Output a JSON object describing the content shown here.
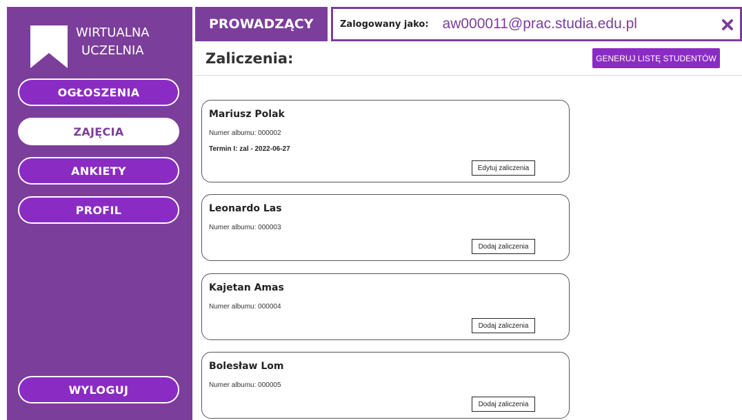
{
  "app": {
    "logo_line1": "WIRTUALNA",
    "logo_line2": "UCZELNIA",
    "logo_icon": "bookmark-icon"
  },
  "sidebar": {
    "items": [
      {
        "label": "OGŁOSZENIA",
        "active": false
      },
      {
        "label": "ZAJĘCIA",
        "active": true
      },
      {
        "label": "ANKIETY",
        "active": false
      },
      {
        "label": "PROFIL",
        "active": false
      }
    ],
    "logout_label": "WYLOGUJ"
  },
  "header": {
    "role": "PROWADZĄCY",
    "login_label": "Zalogowany jako:",
    "login_email": "aw000011@prac.studia.edu.pl",
    "close_icon": "close-icon"
  },
  "main": {
    "title": "Zaliczenia:",
    "generate_button": "GENERUJ LISTĘ STUDENTÓW",
    "students": [
      {
        "name": "Mariusz Polak",
        "album": "Numer albumu: 000002",
        "term": "Termin I: zal - 2022-06-27",
        "button": "Edytuj zaliczenia"
      },
      {
        "name": "Leonardo Las",
        "album": "Numer albumu: 000003",
        "term": "",
        "button": "Dodaj zaliczenia"
      },
      {
        "name": "Kajetan Amas",
        "album": "Numer albumu: 000004",
        "term": "",
        "button": "Dodaj zaliczenia"
      },
      {
        "name": "Bolesław Lom",
        "album": "Numer albumu: 000005",
        "term": "",
        "button": "Dodaj zaliczenia"
      }
    ]
  },
  "colors": {
    "sidebar_bg": "#7b3e9a",
    "button_purple": "#8a2cc4",
    "accent_text": "#7b3e9a"
  }
}
